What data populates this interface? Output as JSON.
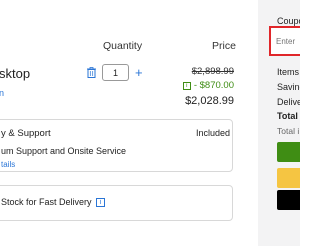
{
  "cart": {
    "headers": {
      "quantity": "Quantity",
      "price": "Price"
    },
    "item": {
      "name": "sktop",
      "sub": "n",
      "quantity": "1",
      "original_price": "$2,898.99",
      "discount": "- $870.00",
      "final_price": "$2,028.99"
    },
    "support_card": {
      "title": "y & Support",
      "included": "Included",
      "line": "um Support and Onsite Service",
      "link": "tails"
    },
    "delivery_card": {
      "text": "Stock for Fast Delivery"
    }
  },
  "summary": {
    "coupon_label": "Coupo",
    "coupon_placeholder": "Enter",
    "items": "Items",
    "savings": "Saving",
    "delivery": "Delive",
    "total": "Total",
    "total_info": "Total i"
  },
  "colors": {
    "accent_blue": "#2a75d6",
    "discount_green": "#3f8d14",
    "coupon_border": "#e0262a",
    "pay_green": "#3f8d14",
    "pay_yellow": "#f5c542",
    "pay_black": "#000000"
  }
}
